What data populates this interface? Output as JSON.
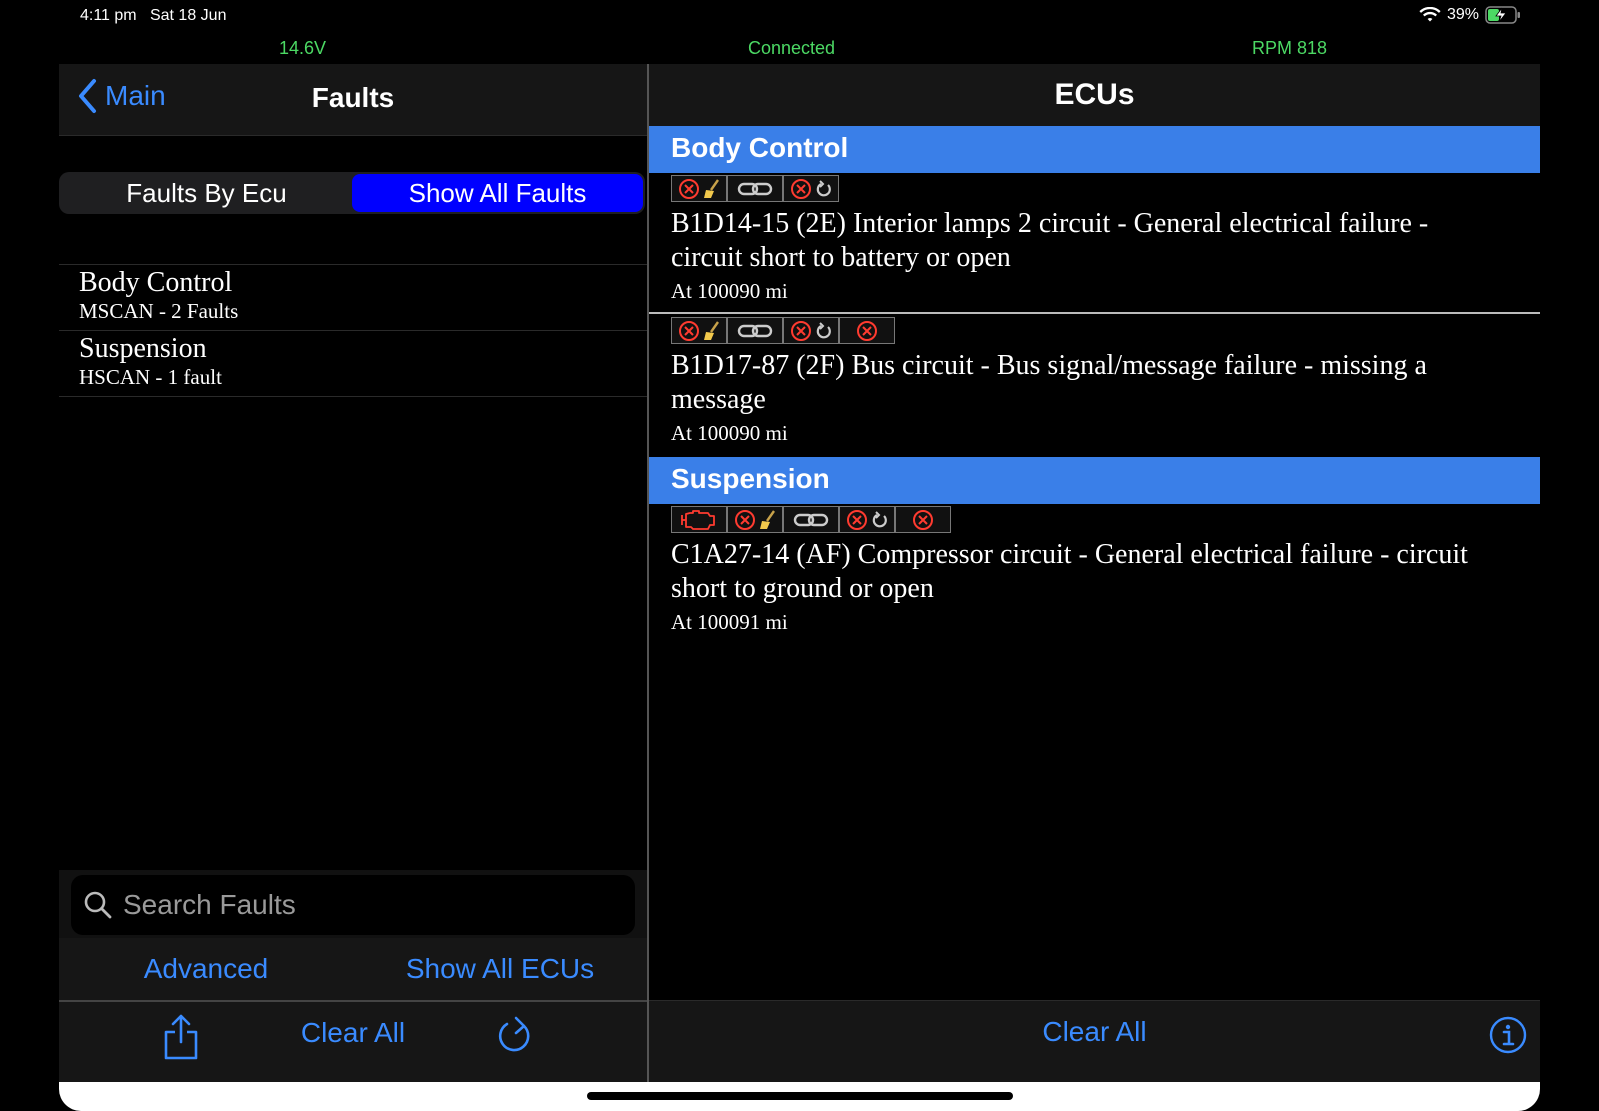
{
  "statusbar": {
    "time": "4:11 pm",
    "date": "Sat 18 Jun",
    "battery": "39%"
  },
  "obd": {
    "voltage": "14.6V",
    "status": "Connected",
    "rpm": "RPM 818",
    "color": "#4cd964"
  },
  "left": {
    "back_label": "Main",
    "title": "Faults",
    "segments": [
      "Faults By Ecu",
      "Show All Faults"
    ],
    "active_segment": "Show All Faults",
    "ecus": [
      {
        "name": "Body Control",
        "sub": "MSCAN - 2 Faults"
      },
      {
        "name": "Suspension",
        "sub": "HSCAN - 1 fault"
      }
    ],
    "search_placeholder": "Search Faults",
    "toolbar": {
      "advanced": "Advanced",
      "show_all_ecus": "Show All ECUs",
      "clear_all": "Clear All"
    }
  },
  "right": {
    "title": "ECUs",
    "sections": [
      {
        "name": "Body Control",
        "faults": [
          {
            "text": "B1D14-15 (2E) Interior lamps 2 circuit - General electrical failure - circuit short to battery or open",
            "mileage": "At 100090 mi",
            "badges": [
              "x-broom",
              "chain",
              "x-cycle"
            ]
          },
          {
            "text": "B1D17-87 (2F) Bus circuit - Bus signal/message failure - missing a message",
            "mileage": "At 100090 mi",
            "badges": [
              "x-broom",
              "chain",
              "x-cycle",
              "x"
            ]
          }
        ]
      },
      {
        "name": "Suspension",
        "faults": [
          {
            "text": "C1A27-14 (AF) Compressor circuit - General electrical failure - circuit short to ground or open",
            "mileage": "At 100091 mi",
            "badges": [
              "engine",
              "x-broom",
              "chain",
              "x-cycle",
              "x"
            ]
          }
        ]
      }
    ],
    "clear_all": "Clear All"
  },
  "colors": {
    "accent": "#3a8bff",
    "section_header": "#3a7fe8",
    "segment_active": "#0000ff",
    "error_red": "#ff3b30"
  }
}
